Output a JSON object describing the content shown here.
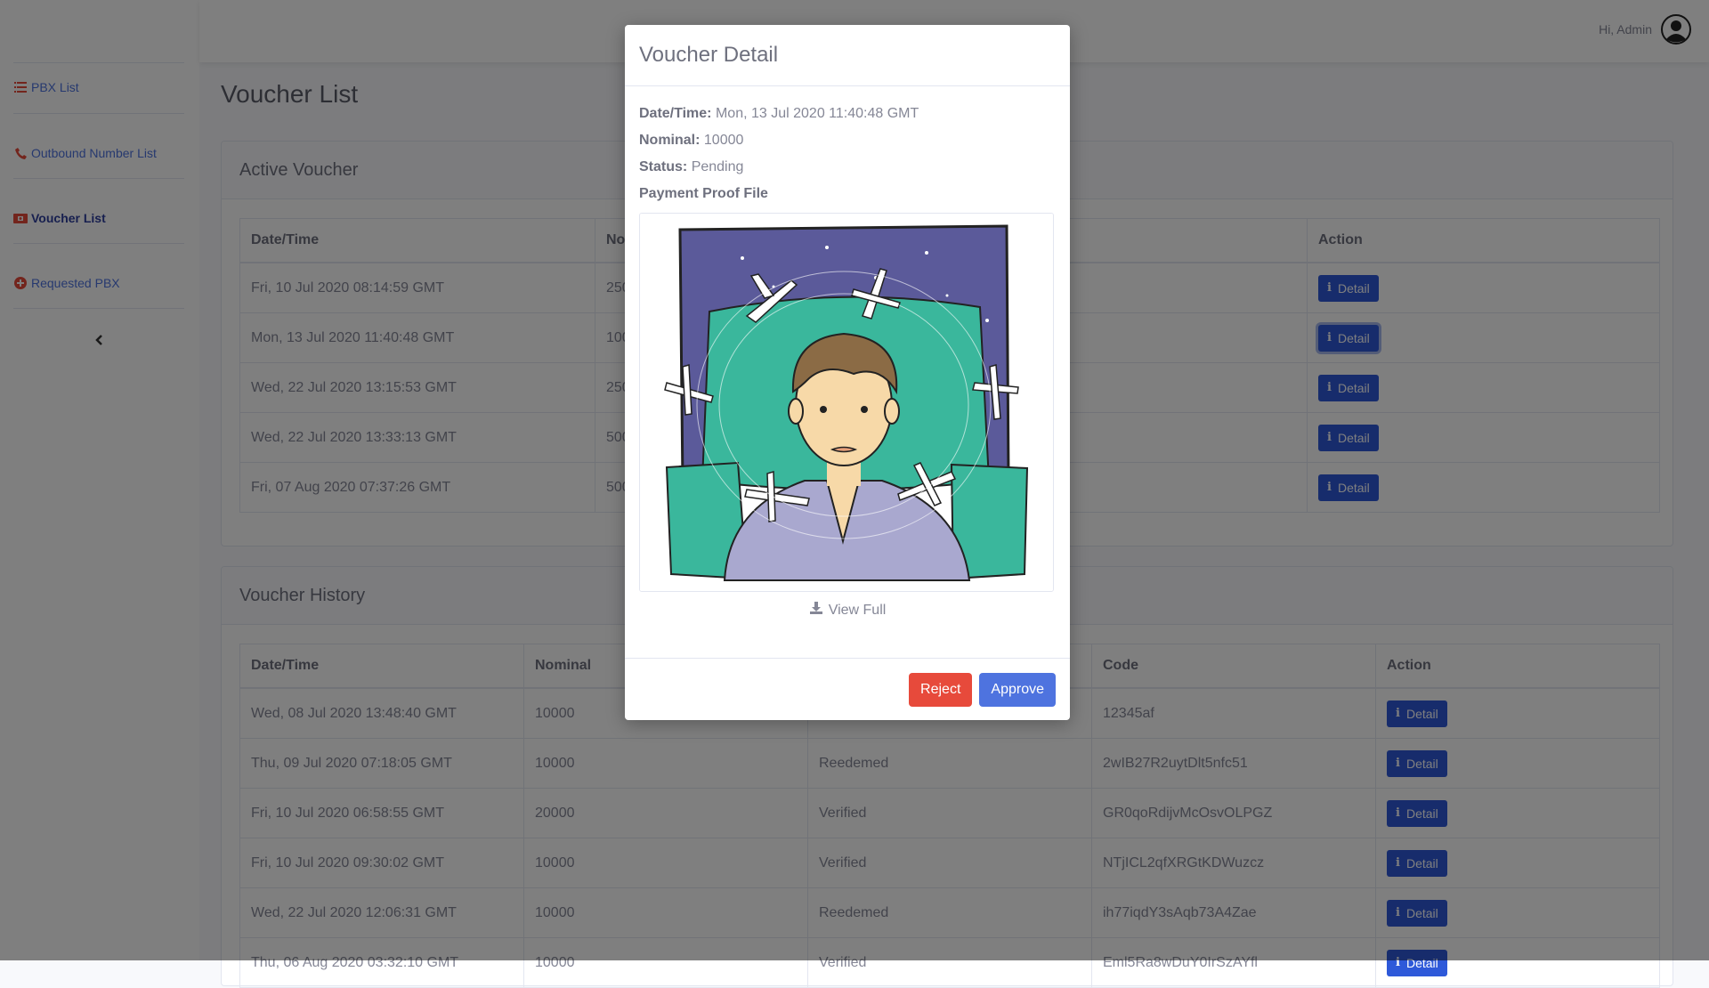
{
  "sidebar": {
    "items": [
      {
        "label": "PBX List",
        "icon": "list-icon"
      },
      {
        "label": "Outbound Number List",
        "icon": "phone-icon"
      },
      {
        "label": "Voucher List",
        "icon": "ticket-icon"
      },
      {
        "label": "Requested PBX",
        "icon": "plus-circle-icon"
      }
    ],
    "toggle_icon": "chevron-left-icon"
  },
  "topbar": {
    "greeting": "Hi, Admin",
    "avatar_icon": "user-avatar-icon"
  },
  "page": {
    "title": "Voucher List"
  },
  "active_voucher": {
    "title": "Active Voucher",
    "columns": [
      "Date/Time",
      "Nominal",
      "Action"
    ],
    "rows": [
      {
        "datetime": "Fri, 10 Jul 2020 08:14:59 GMT",
        "nominal": "250",
        "action": "Detail"
      },
      {
        "datetime": "Mon, 13 Jul 2020 11:40:48 GMT",
        "nominal": "100",
        "action": "Detail"
      },
      {
        "datetime": "Wed, 22 Jul 2020 13:15:53 GMT",
        "nominal": "250",
        "action": "Detail"
      },
      {
        "datetime": "Wed, 22 Jul 2020 13:33:13 GMT",
        "nominal": "500",
        "action": "Detail"
      },
      {
        "datetime": "Fri, 07 Aug 2020 07:37:26 GMT",
        "nominal": "500",
        "action": "Detail"
      }
    ]
  },
  "voucher_history": {
    "title": "Voucher History",
    "columns": [
      "Date/Time",
      "Nominal",
      "",
      "Code",
      "Action"
    ],
    "rows": [
      {
        "datetime": "Wed, 08 Jul 2020 13:48:40 GMT",
        "nominal": "10000",
        "status": "",
        "code": "12345af",
        "action": "Detail"
      },
      {
        "datetime": "Thu, 09 Jul 2020 07:18:05 GMT",
        "nominal": "10000",
        "status": "Reedemed",
        "code": "2wIB27R2uytDlt5nfc51",
        "action": "Detail"
      },
      {
        "datetime": "Fri, 10 Jul 2020 06:58:55 GMT",
        "nominal": "20000",
        "status": "Verified",
        "code": "GR0qoRdijvMcOsvOLPGZ",
        "action": "Detail"
      },
      {
        "datetime": "Fri, 10 Jul 2020 09:30:02 GMT",
        "nominal": "10000",
        "status": "Verified",
        "code": "NTjICL2qfXRGtKDWuzcz",
        "action": "Detail"
      },
      {
        "datetime": "Wed, 22 Jul 2020 12:06:31 GMT",
        "nominal": "10000",
        "status": "Reedemed",
        "code": "ih77iqdY3sAqb73A4Zae",
        "action": "Detail"
      },
      {
        "datetime": "Thu, 06 Aug 2020 03:32:10 GMT",
        "nominal": "10000",
        "status": "Verified",
        "code": "Eml5Ra8wDuY0IrSzAYfl",
        "action": "Detail"
      }
    ]
  },
  "modal": {
    "title": "Voucher Detail",
    "datetime_label": "Date/Time:",
    "datetime_value": "Mon, 13 Jul 2020 11:40:48 GMT",
    "nominal_label": "Nominal:",
    "nominal_value": "10000",
    "status_label": "Status:",
    "status_value": "Pending",
    "proof_label": "Payment Proof File",
    "view_full": "View Full",
    "view_full_icon": "download-icon",
    "reject_label": "Reject",
    "approve_label": "Approve"
  },
  "colors": {
    "primary": "#4e73df",
    "button_blue": "#2e59d9",
    "danger": "#e74a3b",
    "illustration_bg": "#5b5a9a",
    "pillow": "#3ab79c"
  }
}
